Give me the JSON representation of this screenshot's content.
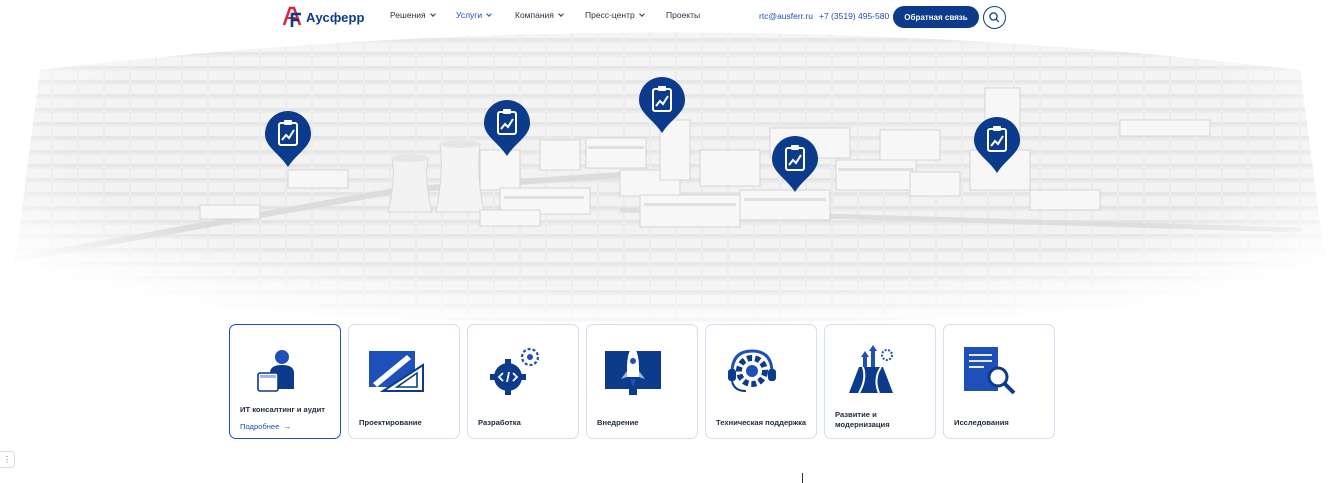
{
  "header": {
    "brand": "Аусферр",
    "nav": [
      {
        "label": "Решения",
        "dropdown": true,
        "active": false
      },
      {
        "label": "Услуги",
        "dropdown": true,
        "active": true
      },
      {
        "label": "Компания",
        "dropdown": true,
        "active": false
      },
      {
        "label": "Пресс-центр",
        "dropdown": true,
        "active": false
      },
      {
        "label": "Проекты",
        "dropdown": false,
        "active": false
      }
    ],
    "email": "rtc@ausferr.ru",
    "phone": "+7 (3519) 495-580",
    "cta_label": "Обратная связь",
    "search_icon": "search-icon"
  },
  "hero": {
    "pin_icon": "report-chart-icon",
    "pin_count": 5
  },
  "cards": [
    {
      "title": "ИТ консалтинг и аудит",
      "icon": "consultant-icon",
      "more": "Подробнее",
      "active": true
    },
    {
      "title": "Проектирование",
      "icon": "drafting-icon",
      "active": false
    },
    {
      "title": "Разработка",
      "icon": "code-gear-icon",
      "active": false
    },
    {
      "title": "Внедрение",
      "icon": "rocket-monitor-icon",
      "active": false
    },
    {
      "title": "Техническая поддержка",
      "icon": "headset-gear-icon",
      "active": false
    },
    {
      "title": "Развитие и модернизация",
      "icon": "growth-road-icon",
      "active": false
    },
    {
      "title": "Исследования",
      "icon": "document-search-icon",
      "active": false
    }
  ],
  "colors": {
    "brand": "#0c3b8c",
    "accent": "#1f4fb8",
    "logo_red": "#d7263d"
  }
}
